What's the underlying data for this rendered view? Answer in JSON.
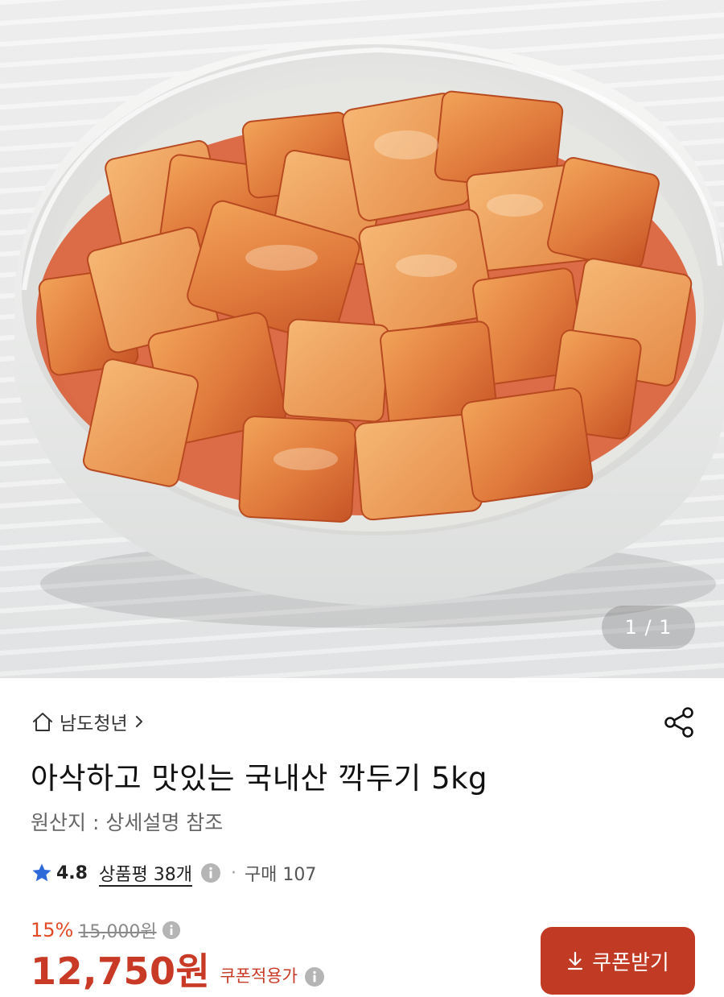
{
  "gallery": {
    "image_alt": "kkakdugi-bowl",
    "pager_text": "1 / 1"
  },
  "store": {
    "name": "남도청년",
    "icon": "home-icon"
  },
  "product": {
    "title": "아삭하고 맛있는 국내산 깍두기 5kg",
    "origin": "원산지 : 상세설명 참조"
  },
  "rating": {
    "value": "4.8",
    "reviews_label": "상품평 38개",
    "separator": "·",
    "purchase_label": "구매 107"
  },
  "pricing": {
    "discount_rate": "15%",
    "original_price": "15,000원",
    "price": "12,750원",
    "price_note": "쿠폰적용가",
    "coupon_button_label": "쿠폰받기"
  },
  "colors": {
    "accent": "#c13a24",
    "price": "#c93a26",
    "discount": "#e24b26",
    "star": "#2f6bd8"
  }
}
